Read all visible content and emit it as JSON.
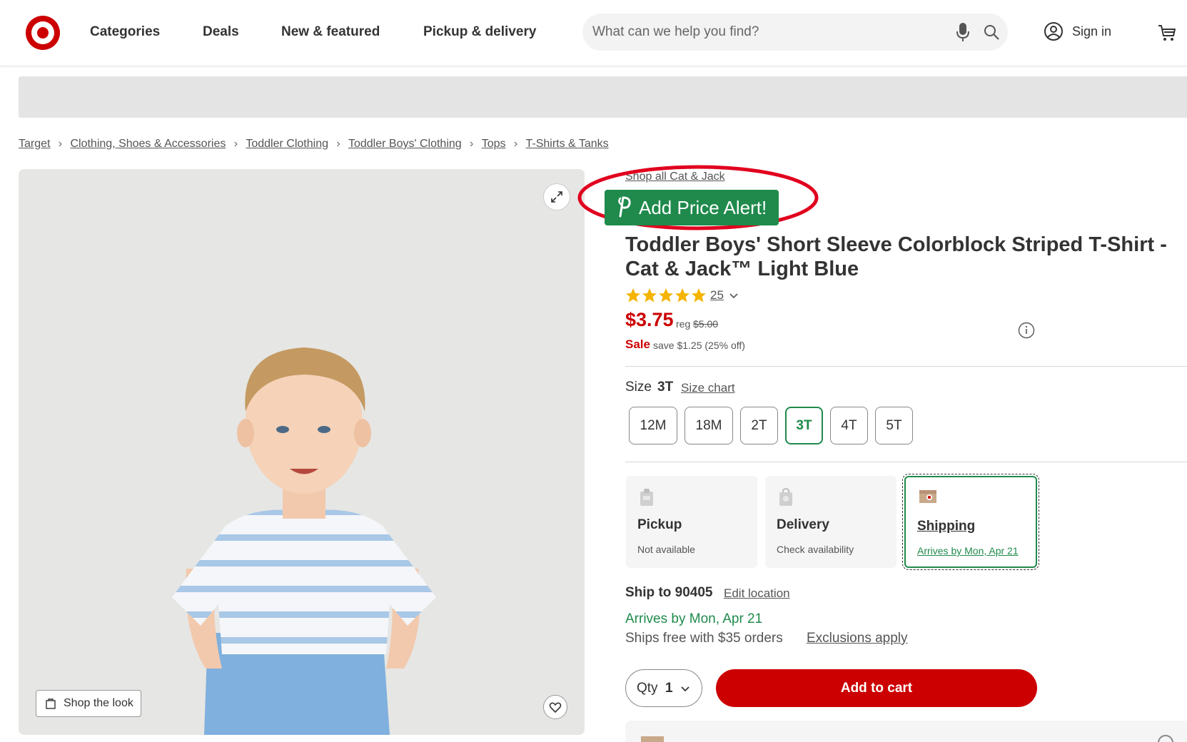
{
  "header": {
    "logo": "target-bullseye-logo",
    "nav": [
      "Categories",
      "Deals",
      "New & featured",
      "Pickup & delivery"
    ],
    "search": {
      "placeholder": "What can we help you find?",
      "value": ""
    },
    "sign_in": "Sign in"
  },
  "breadcrumb": [
    "Target",
    "Clothing, Shoes & Accessories",
    "Toddler Clothing",
    "Toddler Boys' Clothing",
    "Tops",
    "T-Shirts & Tanks"
  ],
  "gallery": {
    "shop_the_look": "Shop the look"
  },
  "product": {
    "shop_all": "Shop all Cat & Jack",
    "price_alert": "Add Price Alert!",
    "title": "Toddler Boys' Short Sleeve Colorblock Striped T-Shirt - Cat & Jack™ Light Blue",
    "rating": {
      "stars": 5,
      "count": "25"
    },
    "price": "$3.75",
    "reg_label": "reg",
    "reg_price": "$5.00",
    "sale_label": "Sale",
    "save_text": "save $1.25 (25% off)"
  },
  "size": {
    "label": "Size",
    "selected": "3T",
    "chart_link": "Size chart",
    "options": [
      "12M",
      "18M",
      "2T",
      "3T",
      "4T",
      "5T"
    ]
  },
  "fulfillment": {
    "cards": [
      {
        "title": "Pickup",
        "sub": "Not available",
        "icon": "store-icon"
      },
      {
        "title": "Delivery",
        "sub": "Check availability",
        "icon": "shopping-bag-icon"
      },
      {
        "title": "Shipping",
        "sub": "Arrives by Mon, Apr 21",
        "icon": "shipping-box-icon"
      }
    ],
    "ship_to": "Ship to 90405",
    "edit_location": "Edit location",
    "arrives": "Arrives by Mon, Apr 21",
    "ships_free": "Ships free with $35 orders",
    "exclusions": "Exclusions apply"
  },
  "purchase": {
    "qty_label": "Qty",
    "qty_value": "1",
    "add_to_cart": "Add to cart"
  },
  "colors": {
    "brand_red": "#cc0000",
    "success_green": "#1f8a4c",
    "annotation_red": "#e1001e"
  }
}
